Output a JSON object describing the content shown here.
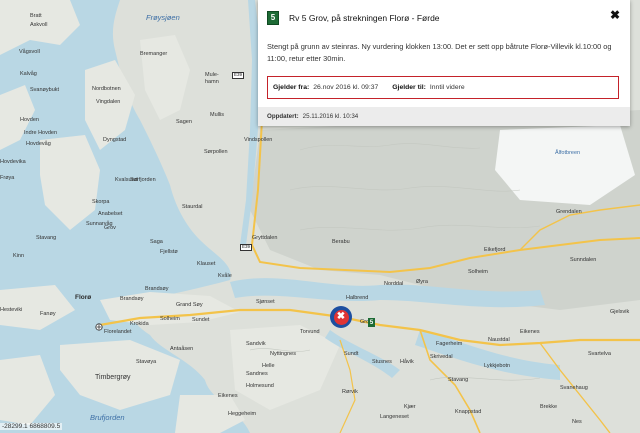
{
  "popup": {
    "road_number": "5",
    "title": "Rv 5 Grov, på strekningen Florø - Førde",
    "description": "Stengt på grunn av steinras. Ny vurdering klokken 13:00. Det er sett opp båtrute Florø-Villevik kl.10:00 og 11:00, retur etter 30min.",
    "valid_from_label": "Gjelder fra:",
    "valid_from_value": "26.nov 2016 kl. 09:37",
    "valid_to_label": "Gjelder til:",
    "valid_to_value": "Inntil videre",
    "updated_label": "Oppdatert:",
    "updated_value": "25.11.2016 kl. 10:34",
    "close_glyph": "✖"
  },
  "marker": {
    "glyph": "✖",
    "road_badge": "5"
  },
  "scale_text": "-28299.1 6868809.5",
  "map": {
    "water_labels": [
      {
        "id": "froysjoen",
        "text": "Frøysjøen"
      },
      {
        "id": "brufjorden",
        "text": "Brufjorden"
      }
    ],
    "route_shields": [
      {
        "id": "e39a",
        "text": "E39"
      },
      {
        "id": "e39b",
        "text": "E39"
      },
      {
        "id": "rv5",
        "text": "5"
      }
    ],
    "places": [
      {
        "id": "p1",
        "text": "Bratt"
      },
      {
        "id": "p2",
        "text": "Askvoll"
      },
      {
        "id": "p3",
        "text": "Ålfotbreen"
      },
      {
        "id": "p4",
        "text": "Vågsvoll"
      },
      {
        "id": "p5",
        "text": "Kalvåg"
      },
      {
        "id": "p6",
        "text": "Svanøybukt"
      },
      {
        "id": "p7",
        "text": "Bremanger"
      },
      {
        "id": "p8",
        "text": "Nordbotnen"
      },
      {
        "id": "p9",
        "text": "Mule-"
      },
      {
        "id": "p10",
        "text": "hamn"
      },
      {
        "id": "p11",
        "text": "Hovden"
      },
      {
        "id": "p12",
        "text": "Indre Hovden"
      },
      {
        "id": "p13",
        "text": "Vingdalen"
      },
      {
        "id": "p14",
        "text": "Sagen"
      },
      {
        "id": "p15",
        "text": "Mullis"
      },
      {
        "id": "p16",
        "text": "Hovdevåg"
      },
      {
        "id": "p17",
        "text": "Hovdevika"
      },
      {
        "id": "p18",
        "text": "Dyngstad"
      },
      {
        "id": "p19",
        "text": "Frøya"
      },
      {
        "id": "p20",
        "text": "Sørpollen"
      },
      {
        "id": "p21",
        "text": "Vindspollen"
      },
      {
        "id": "p22",
        "text": "Skorpa"
      },
      {
        "id": "p23",
        "text": "Kvalsund"
      },
      {
        "id": "p24",
        "text": "Sørfjorden"
      },
      {
        "id": "p25",
        "text": "Sunnarvåg"
      },
      {
        "id": "p26",
        "text": "Stavang"
      },
      {
        "id": "p27",
        "text": "Kinn"
      },
      {
        "id": "p28",
        "text": "Anabelset"
      },
      {
        "id": "p29",
        "text": "Grov"
      },
      {
        "id": "p30",
        "text": "Staurdal"
      },
      {
        "id": "p31",
        "text": "Fjellstø"
      },
      {
        "id": "p32",
        "text": "Saga"
      },
      {
        "id": "p33",
        "text": "Gryttdalen"
      },
      {
        "id": "p34",
        "text": "Berabu"
      },
      {
        "id": "p35",
        "text": "Grendalen"
      },
      {
        "id": "p36",
        "text": "Eikefjord"
      },
      {
        "id": "p37",
        "text": "Solheim"
      },
      {
        "id": "p38",
        "text": "Norddal"
      },
      {
        "id": "p39",
        "text": "Øyra"
      },
      {
        "id": "p40",
        "text": "Sunndalen"
      },
      {
        "id": "p41",
        "text": "Klauset"
      },
      {
        "id": "p42",
        "text": "Kvåle"
      },
      {
        "id": "p43",
        "text": "Brandsøy"
      },
      {
        "id": "p44",
        "text": "Florø"
      },
      {
        "id": "p45",
        "text": "Grand Søy"
      },
      {
        "id": "p46",
        "text": "Solheim"
      },
      {
        "id": "p47",
        "text": "Sundet"
      },
      {
        "id": "p48",
        "text": "Sjønset"
      },
      {
        "id": "p49",
        "text": "Halbrend"
      },
      {
        "id": "p50",
        "text": "Brandsøy"
      },
      {
        "id": "p51",
        "text": "Grov"
      },
      {
        "id": "p52",
        "text": "Krokida"
      },
      {
        "id": "p53",
        "text": "Florelandet"
      },
      {
        "id": "p54",
        "text": "Hesteviki"
      },
      {
        "id": "p55",
        "text": "Fanøy"
      },
      {
        "id": "p56",
        "text": "Torvund"
      },
      {
        "id": "p57",
        "text": "Sandvik"
      },
      {
        "id": "p58",
        "text": "Nyttingnes"
      },
      {
        "id": "p59",
        "text": "Helle"
      },
      {
        "id": "p60",
        "text": "Sandnes"
      },
      {
        "id": "p61",
        "text": "Holmesund"
      },
      {
        "id": "p62",
        "text": "Timbergrøy"
      },
      {
        "id": "p63",
        "text": "Stavøya"
      },
      {
        "id": "p64",
        "text": "Antaåsen"
      },
      {
        "id": "p65",
        "text": "Rørvik"
      },
      {
        "id": "p66",
        "text": "Heggeheim"
      },
      {
        "id": "p67",
        "text": "Langeneset"
      },
      {
        "id": "p68",
        "text": "Eikenes"
      },
      {
        "id": "p69",
        "text": "Naustdal"
      },
      {
        "id": "p70",
        "text": "Lykkjebotn"
      },
      {
        "id": "p71",
        "text": "Stavang"
      },
      {
        "id": "p72",
        "text": "Knappstad"
      },
      {
        "id": "p73",
        "text": "Svartelva"
      },
      {
        "id": "p74",
        "text": "Nes"
      },
      {
        "id": "p75",
        "text": "Svanehaug"
      },
      {
        "id": "p76",
        "text": "Skrivedal"
      },
      {
        "id": "p77",
        "text": "Fagerheim"
      },
      {
        "id": "p78",
        "text": "Håvik"
      },
      {
        "id": "p79",
        "text": "Sundt"
      },
      {
        "id": "p80",
        "text": "Stusnes"
      },
      {
        "id": "p81",
        "text": "Kjær"
      },
      {
        "id": "p82",
        "text": "Eikenes"
      },
      {
        "id": "p83",
        "text": "Gjelsvik"
      },
      {
        "id": "p84",
        "text": "Brekke"
      }
    ]
  }
}
